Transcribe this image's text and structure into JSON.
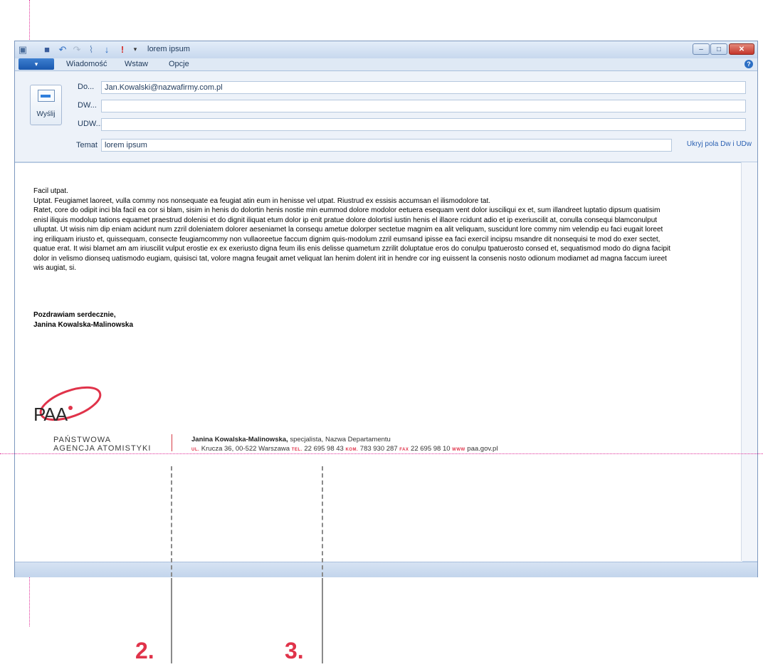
{
  "window": {
    "title": "lorem ipsum",
    "office_button_label": "▾",
    "tabs": [
      "Wiadomość",
      "Wstaw",
      "Opcje"
    ],
    "minimize": "–",
    "maximize": "□",
    "close": "✕",
    "help": "?"
  },
  "compose": {
    "send_label": "Wyślij",
    "to_label": "Do...",
    "to_value": "Jan.Kowalski@nazwafirmy.com.pl",
    "cc_label": "DW...",
    "cc_value": "",
    "bcc_label": "UDW...",
    "bcc_value": "",
    "subject_label": "Temat",
    "subject_value": "lorem ipsum",
    "hide_cc_bcc": "Ukryj pola Dw i UDw"
  },
  "body": {
    "paragraphs": [
      "Facil utpat.",
      "Uptat. Feugiamet laoreet, vulla commy nos nonsequate ea feugiat atin eum in henisse vel utpat. Riustrud ex essisis accumsan el ilismodolore tat.",
      "Ratet, core do odipit inci bla facil ea cor si blam, sisim in henis do dolortin henis nostie min eummod dolore modolor eetuera esequam vent dolor iusciliqui ex et, sum illandreet luptatio dipsum quatisim enisl iliquis modolup tations equamet praestrud dolenisi et do dignit iliquat etum dolor ip enit pratue dolore dolortisl iustin henis el illaore rcidunt adio et ip exeriuscilit at, conulla consequi blamconulput ulluptat. Ut wisis nim dip eniam acidunt num zzril doleniatem dolorer aeseniamet la consequ ametue dolorper sectetue magnim ea alit veliquam, suscidunt lore commy nim velendip eu faci eugait loreet ing eriliquam iriusto et, quissequam, consecte feugiamcommy non vullaoreetue faccum dignim quis-modolum zzril eumsand ipisse ea faci exercil incipsu msandre dit nonsequisi te mod do exer sectet, quatue erat. It wisi blamet am am iriuscilit vulput erostie ex ex exeriusto digna feum ilis enis delisse quametum zzrilit doluptatue eros do conulpu tpatuerosto consed et, sequatismod modo do digna facipit dolor in velismo dionseq uatismodo eugiam, quisisci tat, volore magna feugait amet veliquat lan henim dolent irit in hendre cor ing euissent la consenis nosto odionum modiamet ad magna faccum iureet wis augiat, si."
    ],
    "greeting_line1": "Pozdrawiam serdecznie,",
    "greeting_line2": "Janina Kowalska-Malinowska"
  },
  "signature": {
    "logo_text": "PAA",
    "agency_line1": "PAŃSTWOWA",
    "agency_line2": "AGENCJA ATOMISTYKI",
    "name": "Janina Kowalska-Malinowska,",
    "role": " specjalista, Nazwa Departamentu",
    "ul_label": "UL.",
    "address": " Krucza 36, 00-522 Warszawa ",
    "tel_label": "TEL.",
    "tel": " 22 695 98 43 ",
    "kom_label": "KOM.",
    "kom": " 783 930 287 ",
    "fax_label": "FAX",
    "fax": " 22 695 98 10 ",
    "www_label": "WWW",
    "www": " paa.gov.pl"
  },
  "callouts": [
    "2.",
    "3."
  ],
  "colors": {
    "accent": "#e0334a",
    "guide": "#e0309a",
    "ribbon": "#dfe9f5"
  }
}
